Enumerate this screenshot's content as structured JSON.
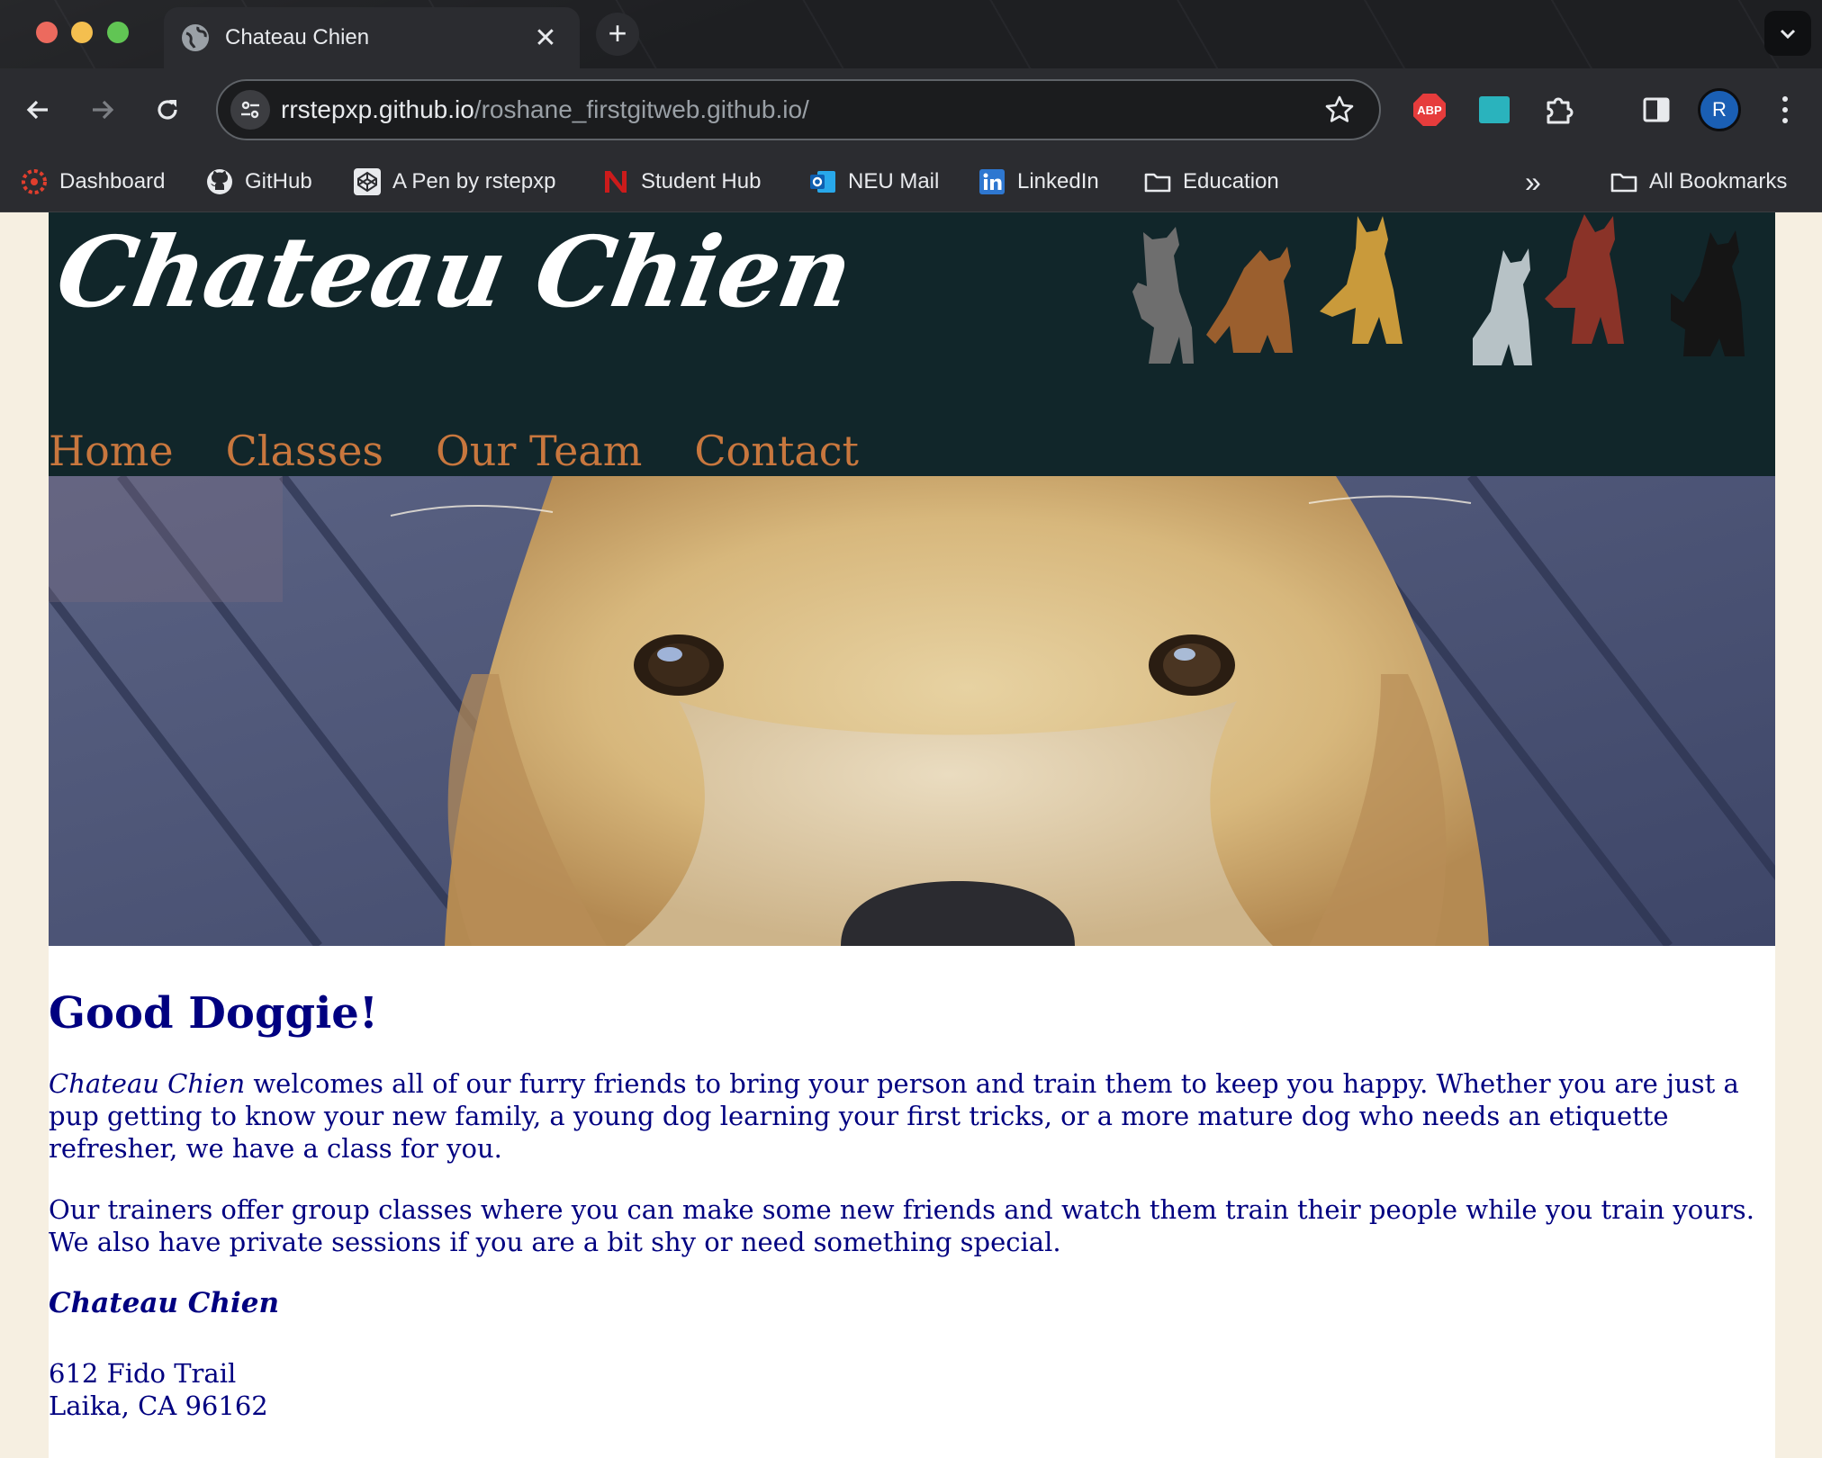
{
  "browser": {
    "tab_title": "Chateau Chien",
    "tab_close": "✕",
    "new_tab": "+",
    "url_host": "rrstepxp.github.io",
    "url_path": "/roshane_firstgitweb.github.io/",
    "ext_abp": "ABP",
    "profile_initial": "R"
  },
  "bookmarks": {
    "items": [
      {
        "label": "Dashboard",
        "icon": "canvas-icon"
      },
      {
        "label": "GitHub",
        "icon": "github-icon"
      },
      {
        "label": "A Pen by rstepxp",
        "icon": "codepen-icon"
      },
      {
        "label": "Student Hub",
        "icon": "northeastern-icon"
      },
      {
        "label": "NEU Mail",
        "icon": "outlook-icon"
      },
      {
        "label": "LinkedIn",
        "icon": "linkedin-icon"
      },
      {
        "label": "Education",
        "icon": "folder-icon"
      }
    ],
    "overflow": "»",
    "all_bookmarks": "All Bookmarks"
  },
  "site": {
    "title": "Chateau Chien",
    "nav": [
      "Home",
      "Classes",
      "Our Team",
      "Contact"
    ],
    "heading": "Good Doggie!",
    "intro_brand": "Chateau Chien",
    "intro_rest": " welcomes all of our furry friends to bring your person and train them to keep you happy. Whether you are just a pup getting to know your new family, a young dog learning your first tricks, or a more mature dog who needs an etiquette refresher, we have a class for you.",
    "para2": "Our trainers offer group classes where you can make some new friends and watch them train their people while you train yours. We also have private sessions if you are a bit shy or need something special.",
    "footer_brand": "Chateau Chien",
    "address_line1": "612 Fido Trail",
    "address_line2": "Laika, CA 96162"
  },
  "colors": {
    "header_bg": "#11262a",
    "nav_link": "#c8773e",
    "body_text": "#000080",
    "page_margin": "#f6efe1"
  }
}
